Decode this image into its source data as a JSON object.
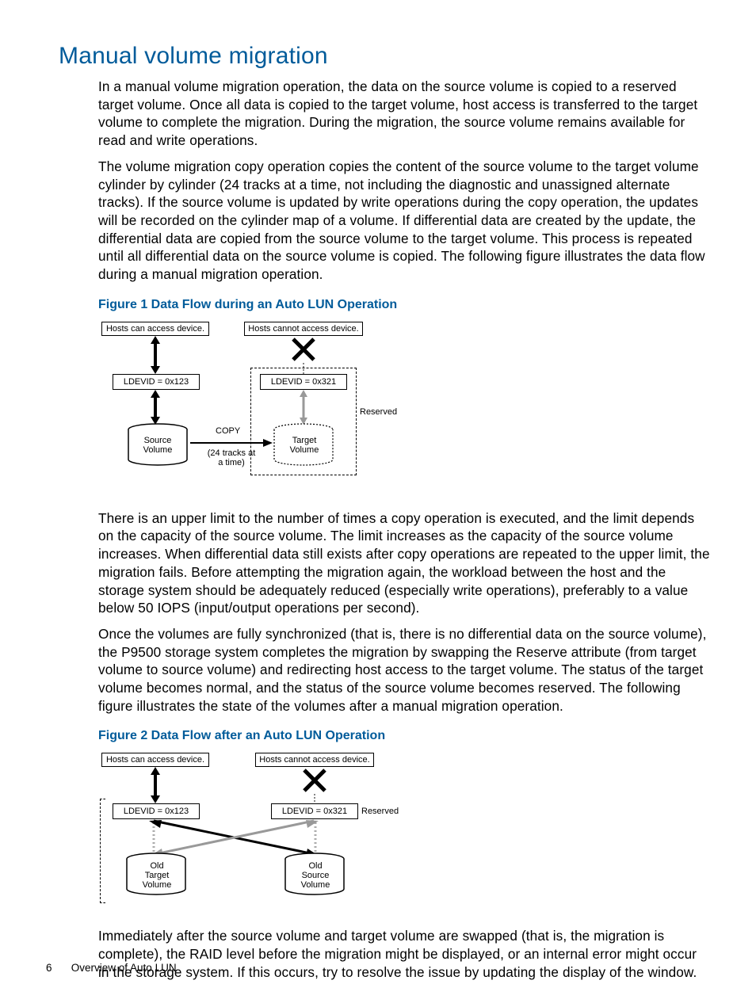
{
  "heading": "Manual volume migration",
  "paragraphs": {
    "p1": "In a manual volume migration operation, the data on the source volume is copied to a reserved target volume. Once all data is copied to the target volume, host access is transferred to the target volume to complete the migration. During the migration, the source volume remains available for read and write operations.",
    "p2": "The volume migration copy operation copies the content of the source volume to the target volume cylinder by cylinder (24 tracks at a time, not including the diagnostic and unassigned alternate tracks). If the source volume is updated by write operations during the copy operation, the updates will be recorded on the cylinder map of a volume. If differential data are created by the update, the differential data are copied from the source volume to the target volume. This process is repeated until all differential data on the source volume is copied. The following figure illustrates the data flow during a manual migration operation.",
    "p3": "There is an upper limit to the number of times a copy operation is executed, and the limit depends on the capacity of the source volume. The limit increases as the capacity of the source volume increases. When differential data still exists after copy operations are repeated to the upper limit, the migration fails. Before attempting the migration again, the workload between the host and the storage system should be adequately reduced (especially write operations), preferably to a value below 50 IOPS (input/output operations per second).",
    "p4": "Once the volumes are fully synchronized (that is, there is no differential data on the source volume), the P9500 storage system completes the migration by swapping the Reserve attribute (from target volume to source volume) and redirecting host access to the target volume. The status of the target volume becomes normal, and the status of the source volume becomes reserved. The following figure illustrates the state of the volumes after a manual migration operation.",
    "p5": "Immediately after the source volume and target volume are swapped (that is, the migration is complete), the RAID level before the migration might be displayed, or an internal error might occur in the storage system. If this occurs, try to resolve the issue by updating the display of the window."
  },
  "figures": {
    "f1_caption": "Figure 1 Data Flow during an Auto LUN Operation",
    "f2_caption": "Figure 2 Data Flow after an Auto LUN Operation"
  },
  "diagram1": {
    "hosts_can": "Hosts can access device.",
    "hosts_cannot": "Hosts cannot access device.",
    "ldev_left": "LDEVID = 0x123",
    "ldev_right": "LDEVID = 0x321",
    "source": "Source\nVolume",
    "target": "Target\nVolume",
    "copy": "COPY",
    "tracks": "(24 tracks at\na time)",
    "reserved": "Reserved"
  },
  "diagram2": {
    "hosts_can": "Hosts can access device.",
    "hosts_cannot": "Hosts cannot access device.",
    "ldev_left": "LDEVID = 0x123",
    "ldev_right": "LDEVID = 0x321",
    "old_target": "Old\nTarget\nVolume",
    "old_source": "Old\nSource\nVolume",
    "reserved": "Reserved"
  },
  "footer": {
    "page_number": "6",
    "chapter": "Overview of Auto LUN"
  }
}
